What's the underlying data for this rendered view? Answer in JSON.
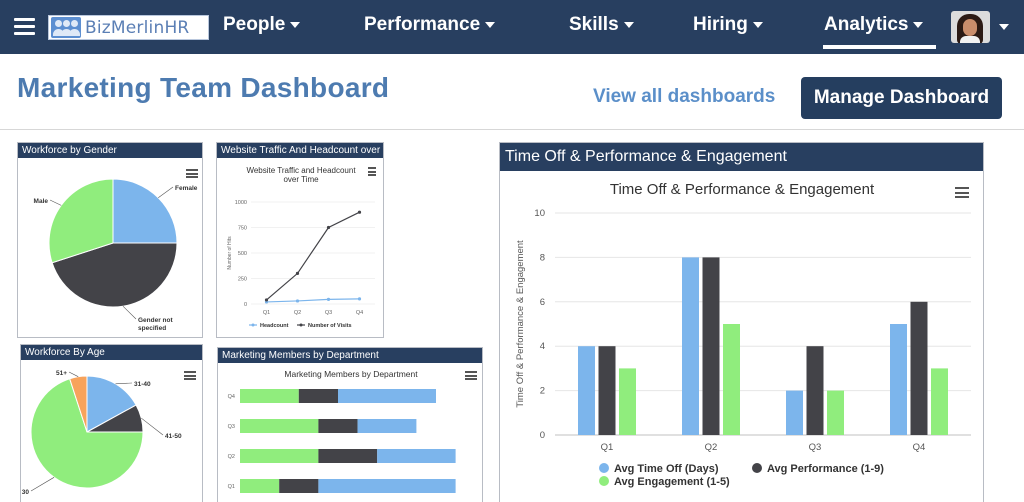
{
  "nav": {
    "logo_text": "BizMerlinHR",
    "items": [
      {
        "label": "People"
      },
      {
        "label": "Performance"
      },
      {
        "label": "Skills"
      },
      {
        "label": "Hiring"
      },
      {
        "label": "Analytics"
      }
    ],
    "active": "Analytics"
  },
  "header": {
    "title": "Marketing Team Dashboard",
    "view_all": "View all dashboards",
    "manage": "Manage Dashboard"
  },
  "colors": {
    "nav_bg": "#283f60",
    "accent_blue": "#7cb5ec",
    "dark": "#434348",
    "green": "#90ed7d",
    "orange": "#f7a35c"
  },
  "widgets": {
    "gender": {
      "title": "Workforce by Gender"
    },
    "traffic": {
      "title": "Website Traffic And Headcount over Time"
    },
    "age": {
      "title": "Workforce By Age"
    },
    "dept": {
      "title": "Marketing Members by Department"
    },
    "timeoff": {
      "title": "Time Off & Performance & Engagement"
    }
  },
  "chart_data": [
    {
      "id": "gender",
      "type": "pie",
      "labels": [
        "Female",
        "Gender not specified",
        "Male"
      ],
      "values": [
        25,
        45,
        30
      ],
      "colors": [
        "#7cb5ec",
        "#434348",
        "#90ed7d"
      ]
    },
    {
      "id": "traffic",
      "type": "line",
      "title": "Website Traffic and Headcount over Time",
      "categories": [
        "Q1",
        "Q2",
        "Q3",
        "Q4"
      ],
      "ylabel": "Number of Hits",
      "ylim": [
        0,
        1000
      ],
      "yticks": [
        0,
        250,
        500,
        750,
        1000
      ],
      "series": [
        {
          "name": "Headcount",
          "values": [
            20,
            30,
            45,
            50
          ],
          "color": "#7cb5ec"
        },
        {
          "name": "Number of Visits",
          "values": [
            40,
            300,
            750,
            900
          ],
          "color": "#434348"
        }
      ]
    },
    {
      "id": "age",
      "type": "pie",
      "labels": [
        "31-40",
        "41-50",
        "30",
        "51+"
      ],
      "values": [
        17,
        8,
        70,
        5
      ],
      "colors": [
        "#7cb5ec",
        "#434348",
        "#90ed7d",
        "#f7a35c"
      ]
    },
    {
      "id": "dept",
      "type": "bar",
      "title": "Marketing Members by Department",
      "categories": [
        "Q4",
        "Q3",
        "Q2",
        "Q1"
      ],
      "stacked": true,
      "orientation": "horizontal",
      "series": [
        {
          "values": [
            6,
            8,
            8,
            4
          ],
          "color": "#90ed7d"
        },
        {
          "values": [
            4,
            4,
            6,
            4
          ],
          "color": "#434348"
        },
        {
          "values": [
            10,
            6,
            8,
            14
          ],
          "color": "#7cb5ec"
        }
      ]
    },
    {
      "id": "timeoff",
      "type": "bar",
      "title": "Time Off & Performance & Engagement",
      "ylabel": "Time Off & Performance & Engagement",
      "categories": [
        "Q1",
        "Q2",
        "Q3",
        "Q4"
      ],
      "ylim": [
        0,
        10
      ],
      "yticks": [
        0,
        2,
        4,
        6,
        8,
        10
      ],
      "series": [
        {
          "name": "Avg Time Off (Days)",
          "values": [
            4,
            8,
            2,
            5
          ],
          "color": "#7cb5ec"
        },
        {
          "name": "Avg Performance (1-9)",
          "values": [
            4,
            8,
            4,
            6
          ],
          "color": "#434348"
        },
        {
          "name": "Avg Engagement (1-5)",
          "values": [
            3,
            5,
            2,
            3
          ],
          "color": "#90ed7d"
        }
      ],
      "legend": "bottom"
    }
  ]
}
